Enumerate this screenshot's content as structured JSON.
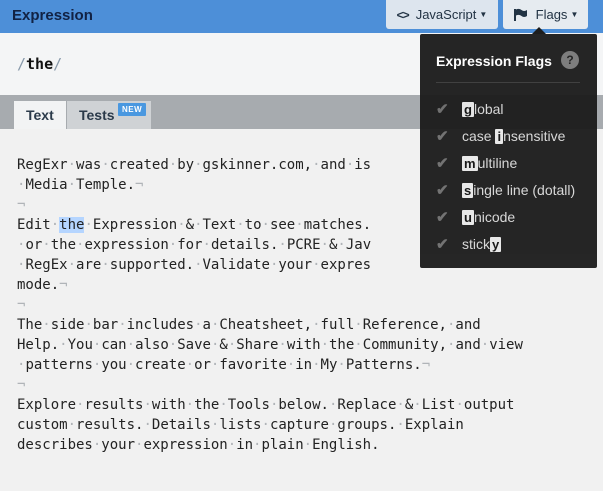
{
  "header": {
    "title": "Expression",
    "flavor_button": {
      "icon_text": "<>",
      "label": "JavaScript"
    },
    "flags_button": {
      "label": "Flags"
    }
  },
  "expression": {
    "open_delim": "/",
    "body": "the",
    "close_delim": "/"
  },
  "tabs": [
    {
      "label": "Text",
      "active": true
    },
    {
      "label": "Tests",
      "active": false,
      "badge": "NEW"
    }
  ],
  "text_lines": [
    "RegExr was created by gskinner.com, and is",
    " Media Temple.",
    "",
    "Edit the Expression & Text to see matches.",
    " or the expression for details. PCRE & Jav",
    " RegEx are supported. Validate your expres",
    "mode.",
    "",
    "The side bar includes a Cheatsheet, full Reference, and",
    "Help. You can also Save & Share with the Community, and view",
    " patterns you create or favorite in My Patterns.",
    "",
    "Explore results with the Tools below. Replace & List output",
    "custom results. Details lists capture groups. Explain",
    "describes your expression in plain English."
  ],
  "line_end_marks": [
    false,
    true,
    true,
    false,
    false,
    false,
    true,
    true,
    false,
    false,
    true,
    true,
    false,
    false,
    false
  ],
  "flags_panel": {
    "title": "Expression Flags",
    "help_icon": "?",
    "items": [
      {
        "key": "g",
        "rest": "lobal",
        "checked": true
      },
      {
        "prefix": "case ",
        "key": "i",
        "rest": "nsensitive",
        "checked": true
      },
      {
        "key": "m",
        "rest": "ultiline",
        "checked": true
      },
      {
        "key": "s",
        "rest": "ingle line (dotall)",
        "checked": true
      },
      {
        "key": "u",
        "rest": "nicode",
        "checked": true
      },
      {
        "prefix": "stick",
        "key": "y",
        "rest": "",
        "checked": true
      }
    ]
  },
  "icons": {
    "flag": "flag-icon",
    "check": "check-icon",
    "caret": "caret-down-icon"
  },
  "colors": {
    "header_bg": "#4d8fd8",
    "match_highlight": "#b5d5ff",
    "panel_bg": "#1d1d1d",
    "badge_bg": "#4a98e0"
  }
}
